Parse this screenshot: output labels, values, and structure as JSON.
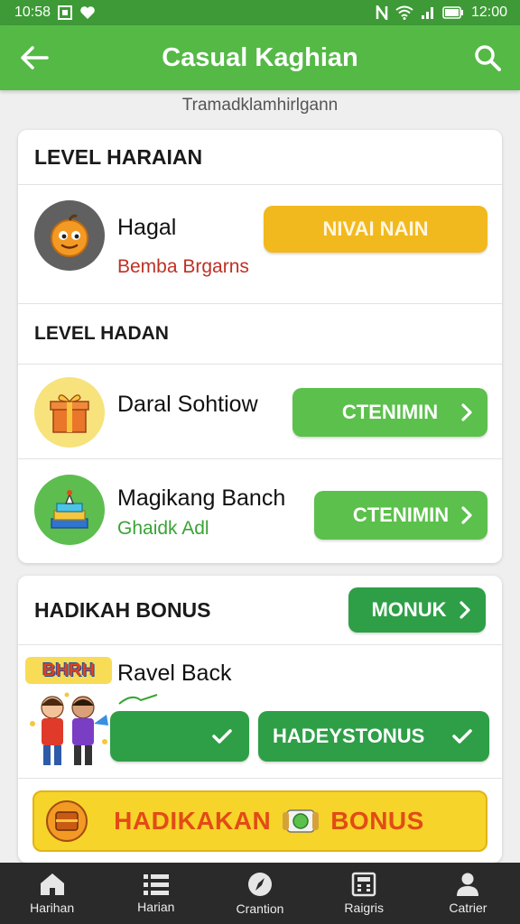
{
  "status_bar": {
    "time": "10:58",
    "battery_time": "12:00"
  },
  "app_bar": {
    "title": "Casual Kaghian"
  },
  "subtitle": "Tramadklamhirlgann",
  "level_harian": {
    "title": "LEVEL HARAIAN",
    "item": {
      "name": "Hagal",
      "sub": "Bemba Brgarns",
      "button": "NIVAI NAIN"
    }
  },
  "level_hadan": {
    "title": "LEVEL HADAN",
    "items": [
      {
        "name": "Daral Sohtiow",
        "button": "CTENIMIN"
      },
      {
        "name": "Magikang Banch",
        "sub": "Ghaidk Adl",
        "button": "CTENIMIN"
      }
    ]
  },
  "hadikah_bonus": {
    "title": "HADIKAH BONUS",
    "button": "MONUK",
    "reward": {
      "name": "Ravel Back",
      "badge_text": "BHRH",
      "button2": "HADEYSTONUS"
    }
  },
  "banner": {
    "left": "HADIKAKAN",
    "right": "BONUS"
  },
  "bottom_nav": [
    "Harihan",
    "Harian",
    "Crantion",
    "Raigris",
    "Catrier"
  ],
  "colors": {
    "app_bar": "#55b946",
    "status_bar": "#3e9a36",
    "yellow_button": "#f2b91e",
    "green_button": "#5cc04c",
    "dark_green_button": "#2e9f47",
    "banner": "#f6d42a",
    "nav_bg": "#2a2a2a"
  }
}
